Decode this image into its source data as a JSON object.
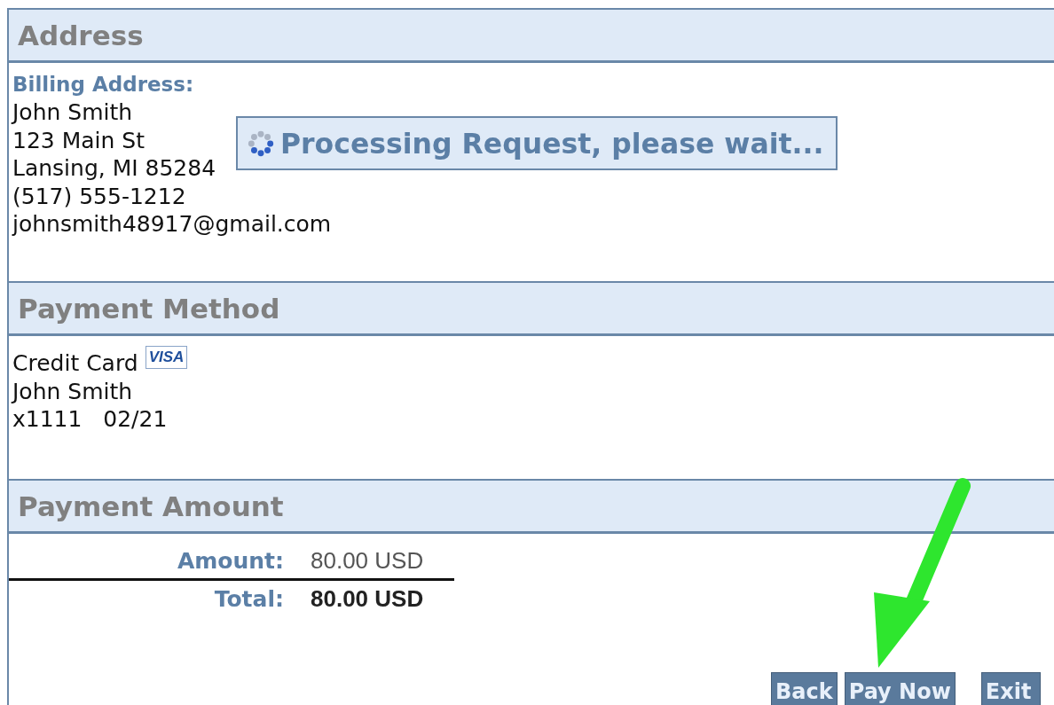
{
  "sections": [
    {
      "kind": "address",
      "title": "Address",
      "label": "Billing Address:",
      "lines": [
        "John Smith",
        "123 Main St",
        "Lansing, MI 85284",
        "(517) 555-1212",
        "johnsmith48917@gmail.com"
      ]
    },
    {
      "kind": "payment",
      "title": "Payment Method",
      "method": "Credit Card",
      "card_badge": "VISA",
      "lines": [
        "John Smith",
        "x1111   02/21"
      ]
    },
    {
      "kind": "amount",
      "title": "Payment Amount",
      "rows": [
        {
          "label": "Amount:",
          "value": "80.00 USD",
          "total": false
        },
        {
          "label": "Total:",
          "value": "80.00 USD",
          "total": true
        }
      ]
    }
  ],
  "overlay": {
    "text": "Processing Request, please wait..."
  },
  "buttons": [
    {
      "label": "Back"
    },
    {
      "label": "Pay Now"
    },
    {
      "label": "Exit"
    }
  ]
}
